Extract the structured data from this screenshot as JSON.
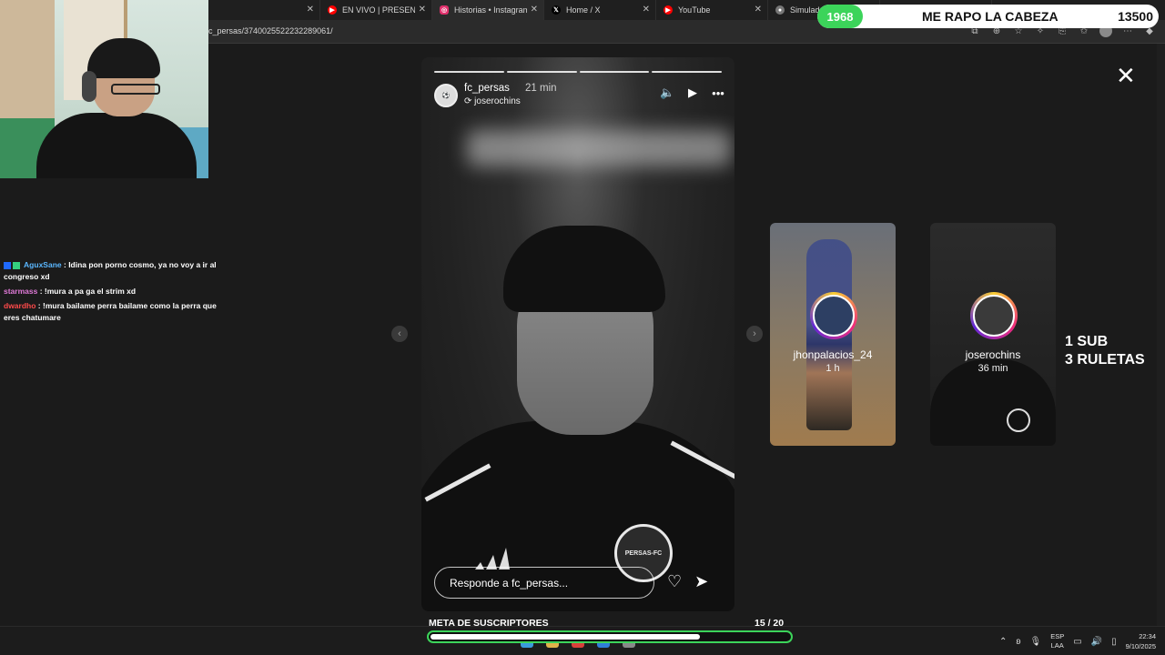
{
  "browser": {
    "tabs": [
      {
        "label": "",
        "icon": "",
        "color": "#1f1f1f"
      },
      {
        "label": "EN VIVO | PRESENTAC",
        "icon": "youtube-icon",
        "color": "#ff0000"
      },
      {
        "label": "Historias • Instagram",
        "icon": "instagram-icon",
        "color": "#e1306c"
      },
      {
        "label": "Home / X",
        "icon": "x-icon",
        "color": "#000000"
      },
      {
        "label": "YouTube",
        "icon": "youtube-icon",
        "color": "#ff0000"
      },
      {
        "label": "Simulador de Alineació",
        "icon": "globe-icon",
        "color": "#777777"
      },
      {
        "label": "",
        "icon": "",
        "color": "#1f1f1f"
      },
      {
        "label": "",
        "icon": "",
        "color": "#1f1f1f"
      }
    ],
    "url": "c_persas/3740025522232289061/"
  },
  "counter": {
    "current": "1968",
    "title": "ME RAPO LA CABEZA",
    "goal": "13500"
  },
  "chat": [
    {
      "user": "AguxSane",
      "text": ": Idina pon porno cosmo, ya no voy a ir al congreso xd"
    },
    {
      "user": "starmass",
      "text": ": !mura a pa ga el strim xd"
    },
    {
      "user": "dwardho",
      "text": ": !mura bailame perra bailame como la perra que eres chatumare"
    }
  ],
  "story": {
    "username": "fc_persas",
    "time": "21 min",
    "reposted_from": "joserochins",
    "reply_placeholder": "Responde a fc_persas...",
    "crest_text": "PERSAS-FC"
  },
  "side_stories": [
    {
      "username": "jhonpalacios_24",
      "time": "1 h"
    },
    {
      "username": "joserochins",
      "time": "36 min"
    }
  ],
  "overlay": {
    "line1": "1 SUB",
    "line2": "3 RULETAS"
  },
  "meta": {
    "label": "META DE SUSCRIPTORES",
    "count": "15   / 20",
    "progress": 0.75
  },
  "taskbar": {
    "lang_top": "ESP",
    "lang_bottom": "LAA",
    "time": "22:34",
    "date": "9/10/2025"
  },
  "colors": {
    "accent_green": "#3cd45a"
  }
}
